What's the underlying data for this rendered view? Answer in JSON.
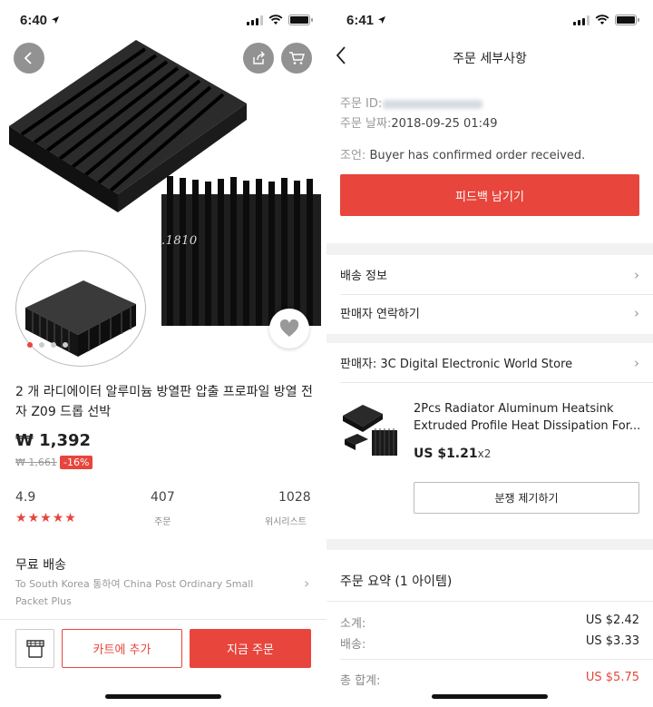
{
  "left": {
    "status": {
      "time": "6:40"
    },
    "product": {
      "watermark": "Store No.1810",
      "title": "2 개 라디에이터 알루미늄 방열판 압출 프로파일 방열 전자 Z09 드롭 선박",
      "price": "₩ 1,392",
      "original_price": "₩ 1,661",
      "discount": "-16%",
      "rating": "4.9",
      "rating_stars": 5,
      "orders": "407",
      "orders_label": "주문",
      "wishlist": "1028",
      "wishlist_label": "위시리스트",
      "gallery_images": 4,
      "gallery_active": 1
    },
    "shipping": {
      "title": "무료 배송",
      "desc": "To South Korea 통하여 China Post Ordinary Small Packet Plus"
    },
    "actions": {
      "add_to_cart": "카트에 추가",
      "buy_now": "지금 주문"
    }
  },
  "right": {
    "status": {
      "time": "6:41"
    },
    "header": {
      "title": "주문 세부사항"
    },
    "order": {
      "id_label": "주문 ID:",
      "date_label": "주문 날짜:",
      "date_value": "2018-09-25 01:49",
      "status_label": "조언:",
      "status_value": "Buyer has confirmed order received."
    },
    "feedback_button": "피드백 남기기",
    "rows": {
      "shipping_info": "배송 정보",
      "contact_seller": "판매자 연락하기"
    },
    "seller": {
      "label": "판매자: 3C Digital Electronic World Store"
    },
    "item": {
      "name_line1": "2Pcs Radiator Aluminum Heatsink",
      "name_line2": "Extruded Profile Heat Dissipation For...",
      "price": "US $1.21",
      "qty": "x2",
      "dispute_button": "분쟁 제기하기"
    },
    "summary": {
      "title": "주문 요약 (1 아이템)",
      "subtotal_label": "소계:",
      "subtotal_value": "US $2.42",
      "shipping_label": "배송:",
      "shipping_value": "US $3.33",
      "total_label": "총 합계:",
      "total_value": "US $5.75"
    },
    "colors": {
      "accent": "#e8453c"
    }
  }
}
